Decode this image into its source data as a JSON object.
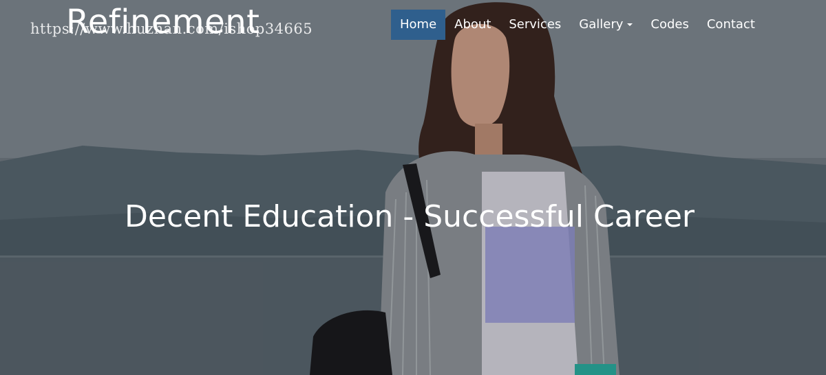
{
  "brand": {
    "name": "Refinement"
  },
  "watermark": {
    "text": "https://www.huzhan.com/ishop34665"
  },
  "nav": {
    "items": [
      {
        "label": "Home",
        "active": true
      },
      {
        "label": "About",
        "active": false
      },
      {
        "label": "Services",
        "active": false
      },
      {
        "label": "Gallery",
        "active": false,
        "dropdown": true
      },
      {
        "label": "Codes",
        "active": false
      },
      {
        "label": "Contact",
        "active": false
      }
    ]
  },
  "hero": {
    "headline": "Decent Education - Successful Career",
    "image": "woman-by-the-sea-photo"
  },
  "colors": {
    "active_nav_bg": "#2f5f8d",
    "text": "#ffffff"
  }
}
